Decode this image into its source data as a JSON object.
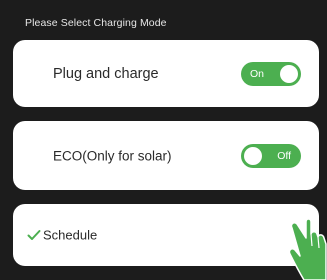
{
  "header": {
    "title": "Please Select Charging Mode"
  },
  "options": [
    {
      "label": "Plug and charge",
      "toggle_text": "On",
      "state": "on"
    },
    {
      "label": "ECO(Only for solar)",
      "toggle_text": "Off",
      "state": "off"
    },
    {
      "label": "Schedule",
      "selected": true
    }
  ],
  "icons": {
    "check": "check-icon",
    "hand": "hand-pointer-icon"
  },
  "colors": {
    "accent": "#4caf50",
    "background": "#1c1c1c",
    "card": "#ffffff"
  }
}
